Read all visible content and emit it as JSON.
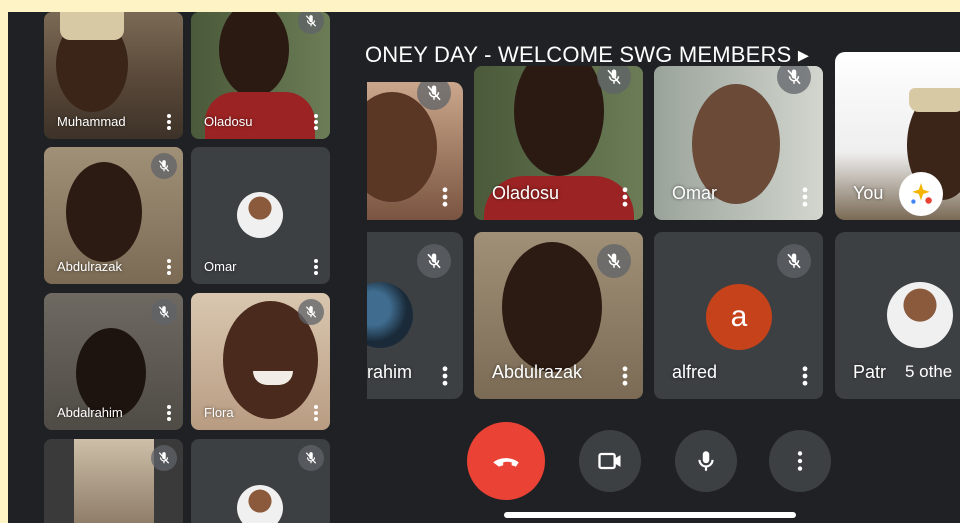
{
  "meeting": {
    "title": "ONEY DAY - WELCOME SWG MEMBERS ▸"
  },
  "sidebar": {
    "tiles": [
      {
        "name": "Muhammad"
      },
      {
        "name": "Oladosu"
      },
      {
        "name": "Abdulrazak"
      },
      {
        "name": "Omar"
      },
      {
        "name": "Abdalrahim"
      },
      {
        "name": "Flora"
      },
      {
        "name": ""
      },
      {
        "name": ""
      }
    ]
  },
  "grid": {
    "tiles": [
      {
        "name": ""
      },
      {
        "name": "Oladosu"
      },
      {
        "name": "Omar"
      },
      {
        "name": "You"
      },
      {
        "name": "rahim"
      },
      {
        "name": "Abdulrazak"
      },
      {
        "name": "alfred",
        "avatar_letter": "a"
      },
      {
        "name": "Patr"
      }
    ],
    "others_label": "5 othe"
  },
  "controls": {
    "end_call_icon": "phone-hangup-icon",
    "camera_icon": "video-camera-icon",
    "mic_icon": "microphone-icon",
    "more_icon": "more-vertical-icon"
  },
  "colors": {
    "end_call": "#ea4335",
    "control_bg": "#3c4043",
    "avatar_alfred": "#c5421a",
    "panel_bg": "#202124"
  }
}
